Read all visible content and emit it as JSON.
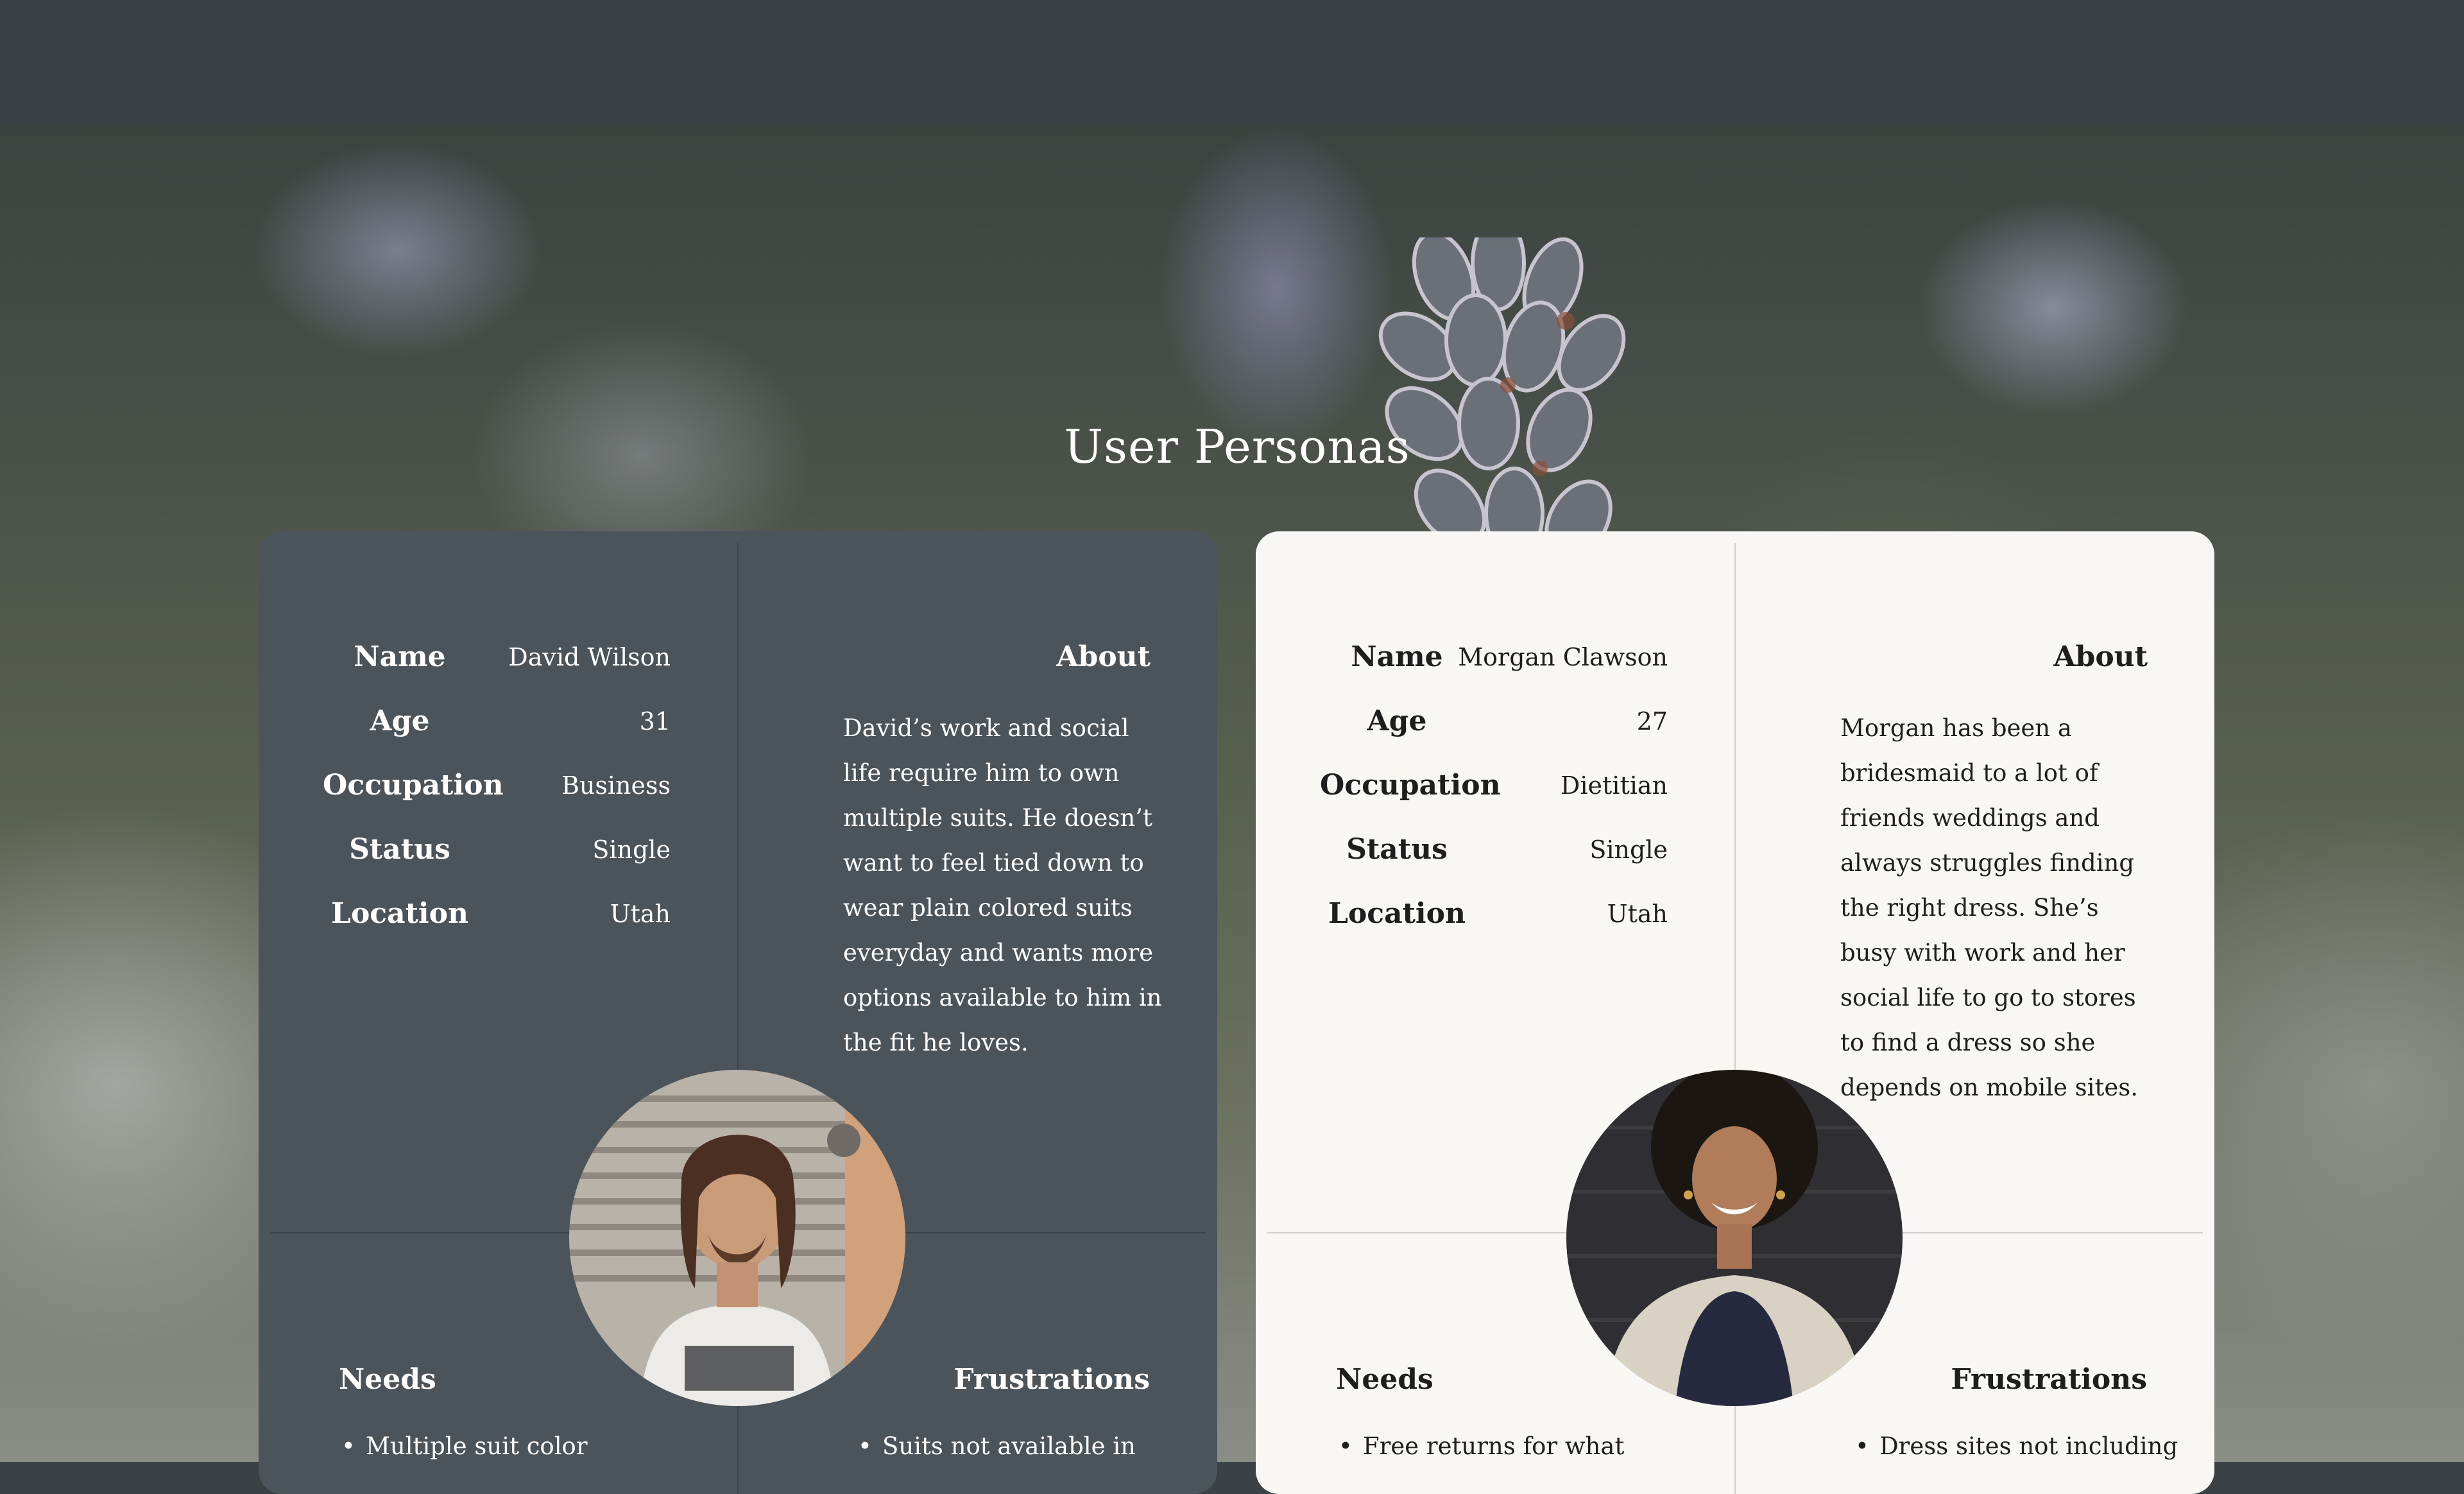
{
  "page": {
    "title": "User Personas"
  },
  "personas": [
    {
      "theme": "dark",
      "card_color": "#4b535b",
      "fields": [
        {
          "label": "Name",
          "value": "David Wilson"
        },
        {
          "label": "Age",
          "value": "31"
        },
        {
          "label": "Occupation",
          "value": "Business"
        },
        {
          "label": "Status",
          "value": "Single"
        },
        {
          "label": "Location",
          "value": "Utah"
        }
      ],
      "about_title": "About",
      "about_text": "David’s work and social life require him to own multiple suits. He doesn’t want to feel tied down to wear plain colored suits everyday and wants more options available to him in the fit he loves.",
      "needs_title": "Needs",
      "needs": [
        "Multiple suit color"
      ],
      "frustrations_title": "Frustrations",
      "frustrations": [
        "Suits not available in"
      ]
    },
    {
      "theme": "light",
      "card_color": "#f8f7f4",
      "fields": [
        {
          "label": "Name",
          "value": "Morgan Clawson"
        },
        {
          "label": "Age",
          "value": "27"
        },
        {
          "label": "Occupation",
          "value": "Dietitian"
        },
        {
          "label": "Status",
          "value": "Single"
        },
        {
          "label": "Location",
          "value": "Utah"
        }
      ],
      "about_title": "About",
      "about_text": "Morgan has been a bridesmaid to a lot of friends weddings and always struggles finding the right dress. She’s busy with work and her social life to go to stores to find a dress so she depends on mobile sites.",
      "needs_title": "Needs",
      "needs": [
        "Free returns for what"
      ],
      "frustrations_title": "Frustrations",
      "frustrations": [
        "Dress sites not including"
      ]
    }
  ]
}
